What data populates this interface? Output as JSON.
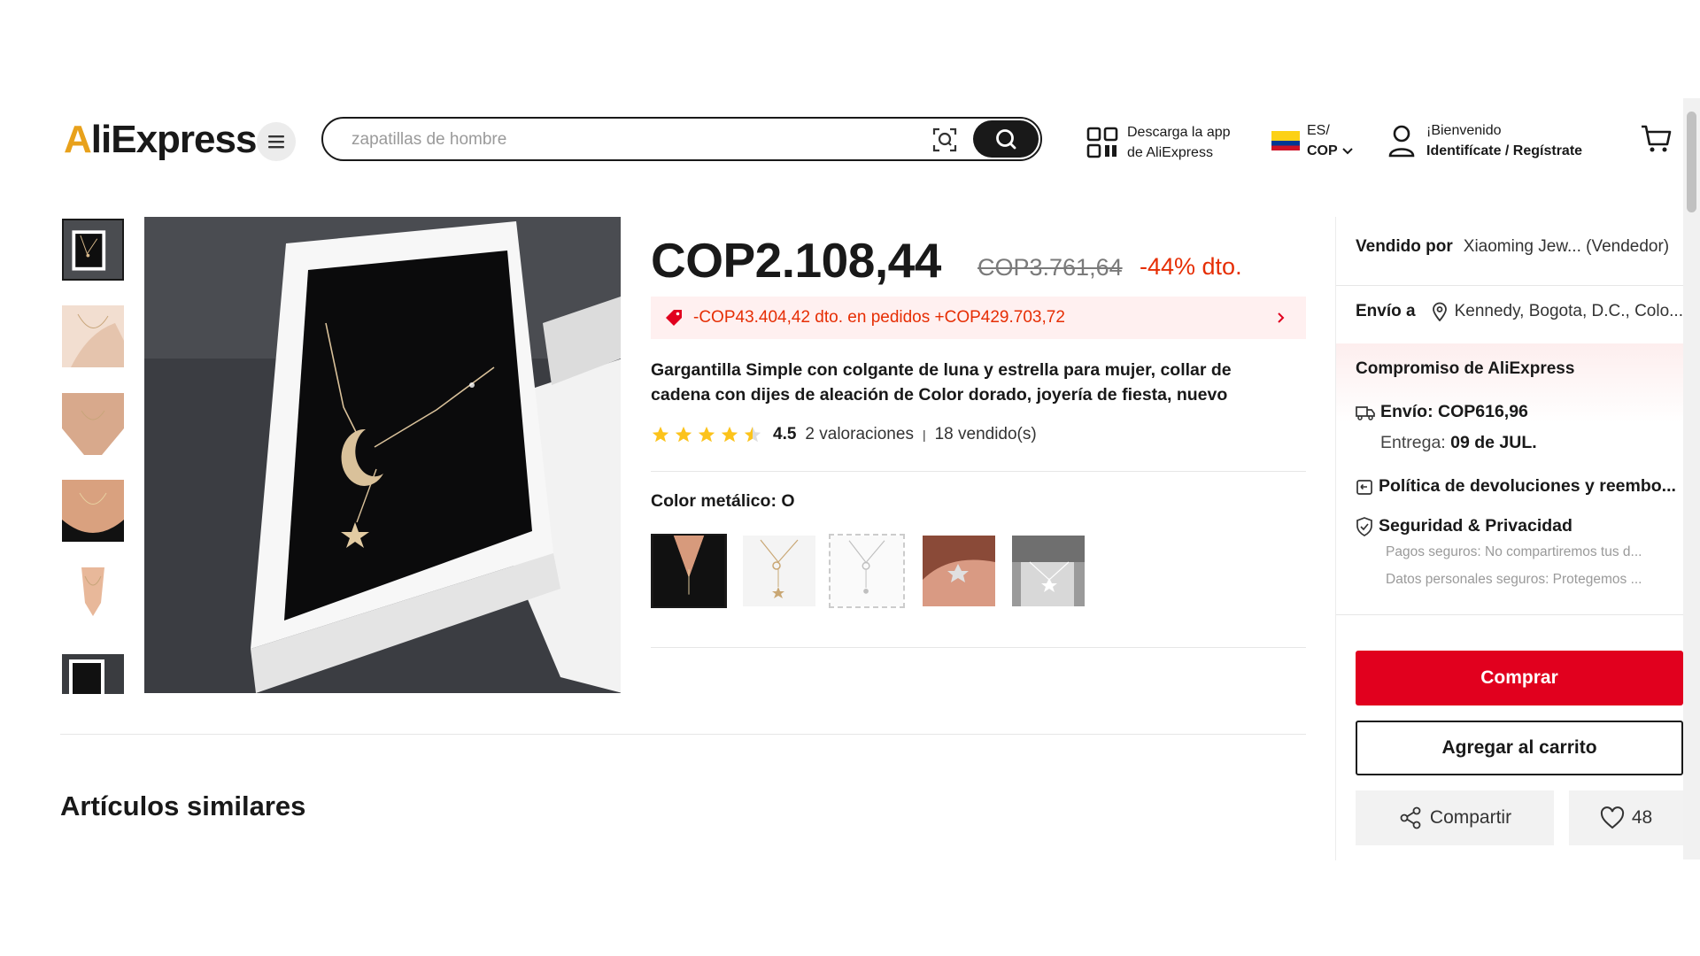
{
  "header": {
    "logo_main": "AliExpress",
    "search_placeholder": "zapatillas de hombre",
    "app_line1": "Descarga la app",
    "app_line2": "de AliExpress",
    "lang": "ES/",
    "currency": "COP",
    "welcome": "¡Bienvenido",
    "signin": "Identifícate / Regístrate"
  },
  "product": {
    "price": "COP2.108,44",
    "original_price": "COP3.761,64",
    "discount": "-44% dto.",
    "coupon": "-COP43.404,42 dto. en pedidos +COP429.703,72",
    "title": "Gargantilla Simple con colgante de luna y estrella para mujer, collar de cadena con dijes de aleación de Color dorado, joyería de fiesta, nuevo",
    "rating": 4.5,
    "rating_text": "4.5",
    "reviews": "2 valoraciones",
    "sold": "18 vendido(s)",
    "color_label": "Color metálico: O"
  },
  "similar_title": "Artículos similares",
  "side": {
    "sold_by_label": "Vendido por",
    "seller": "Xiaoming Jew... (Vendedor)",
    "ship_to_label": "Envío a",
    "ship_to": "Kennedy, Bogota, D.C., Colo...",
    "promise_title": "Compromiso de AliExpress",
    "shipping": "Envío: COP616,96",
    "delivery_label": "Entrega:",
    "delivery_date": "09 de JUL.",
    "returns": "Política de devoluciones y reembo...",
    "security": "Seguridad & Privacidad",
    "security_sub1": "Pagos seguros: No compartiremos tus d...",
    "security_sub2": "Datos personales seguros: Protegemos ...",
    "buy": "Comprar",
    "add_cart": "Agregar al carrito",
    "share": "Compartir",
    "wishlist_count": "48"
  },
  "colors": {
    "accent_red": "#e1001e",
    "discount_red": "#e62e04",
    "coupon_bg": "#fff0f0",
    "star": "#fcc31b"
  }
}
